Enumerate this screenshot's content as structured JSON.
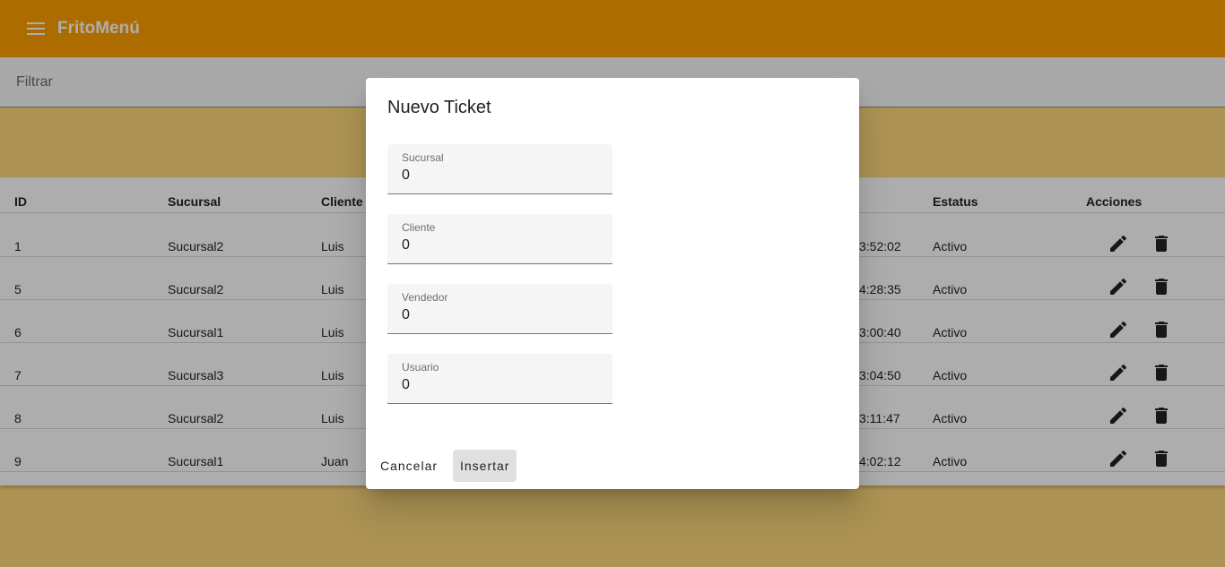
{
  "app": {
    "title": "FritoMenú",
    "accent_color": "#ffa000"
  },
  "filter": {
    "placeholder": "Filtrar"
  },
  "table": {
    "columns": {
      "id": "ID",
      "sucursal": "Sucursal",
      "cliente": "Cliente",
      "estatus": "Estatus",
      "acciones": "Acciones"
    },
    "rows": [
      {
        "id": "1",
        "sucursal": "Sucursal2",
        "cliente": "Luis",
        "fecha_visible": "3:52:02",
        "estatus": "Activo"
      },
      {
        "id": "5",
        "sucursal": "Sucursal2",
        "cliente": "Luis",
        "fecha_visible": "4:28:35",
        "estatus": "Activo"
      },
      {
        "id": "6",
        "sucursal": "Sucursal1",
        "cliente": "Luis",
        "fecha_visible": "3:00:40",
        "estatus": "Activo"
      },
      {
        "id": "7",
        "sucursal": "Sucursal3",
        "cliente": "Luis",
        "fecha_visible": "3:04:50",
        "estatus": "Activo"
      },
      {
        "id": "8",
        "sucursal": "Sucursal2",
        "cliente": "Luis",
        "fecha_visible": "3:11:47",
        "estatus": "Activo"
      },
      {
        "id": "9",
        "sucursal": "Sucursal1",
        "cliente": "Juan",
        "fecha_visible": "4:02:12",
        "estatus": "Activo"
      }
    ],
    "row_actions": [
      "edit-icon",
      "delete-icon"
    ]
  },
  "dialog": {
    "title": "Nuevo Ticket",
    "fields": [
      {
        "label": "Sucursal",
        "value": "0"
      },
      {
        "label": "Cliente",
        "value": "0"
      },
      {
        "label": "Vendedor",
        "value": "0"
      },
      {
        "label": "Usuario",
        "value": "0"
      }
    ],
    "cancel_label": "Cancelar",
    "insert_label": "Insertar"
  }
}
